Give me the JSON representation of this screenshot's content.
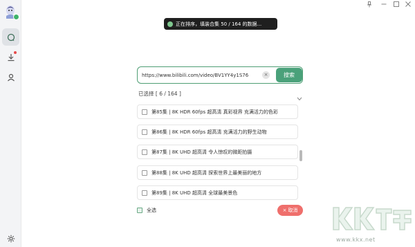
{
  "toast": {
    "text": "正在排序，填装合集 50 / 164 的数据..."
  },
  "url_bar": {
    "value": "https://www.bilibili.com/video/BV1YY4y1S76",
    "clear_glyph": "×",
    "search_label": "搜索"
  },
  "selection": {
    "count_text": "已选择 [ 6 / 164 ]"
  },
  "episodes": [
    {
      "label": "第85集 | 8K HDR 60fps 超高清 真彩视界 充满活力的色彩"
    },
    {
      "label": "第86集 | 8K HDR 60fps 超高清 充满活力的野生动物"
    },
    {
      "label": "第87集 | 8K UHD 超高清 令人惊叹的微距拍摄"
    },
    {
      "label": "第88集 | 8K UHD 超高清 探索世界上最美丽的地方"
    },
    {
      "label": "第89集 | 8K UHD 超高清 全球最美景色"
    }
  ],
  "footer": {
    "select_all_label": "全选",
    "cancel_label": "取消",
    "cancel_glyph": "×"
  },
  "watermark": {
    "text": "www.kkx.net"
  },
  "colors": {
    "accent": "#4aa17a",
    "cancel": "#ef6f6c",
    "sidebar_bg": "#f3f4f6",
    "toast_bg": "#1f1f1f"
  },
  "icons": {
    "sidebar": [
      "app-logo",
      "search-icon",
      "download-icon",
      "user-icon",
      "settings-icon"
    ],
    "window": [
      "pin-icon",
      "minimize-icon",
      "maximize-icon",
      "close-icon"
    ]
  }
}
